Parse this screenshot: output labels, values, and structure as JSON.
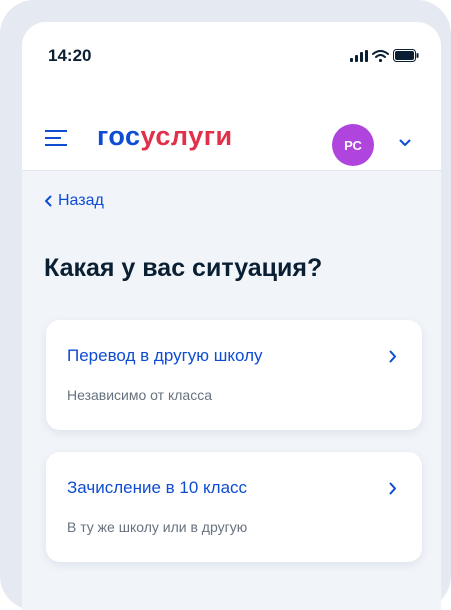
{
  "status_bar": {
    "time": "14:20",
    "icons": [
      "signal-icon",
      "wifi-icon",
      "battery-icon"
    ]
  },
  "header": {
    "logo_part1": "гос",
    "logo_part2": "услуги",
    "avatar_initials": "РС",
    "icons": [
      "menu-icon",
      "chevron-down-icon"
    ]
  },
  "nav": {
    "back_label": "Назад"
  },
  "page": {
    "title": "Какая у вас ситуация?"
  },
  "options": [
    {
      "title": "Перевод в другую школу",
      "subtitle": "Независимо от класса"
    },
    {
      "title": "Зачисление в 10 класс",
      "subtitle": "В ту же школу или в другую"
    }
  ],
  "colors": {
    "brand_blue": "#0d4cd3",
    "brand_red": "#e3304a",
    "avatar": "#b045de",
    "text_dark": "#0b1f33",
    "text_muted": "#66727f"
  }
}
